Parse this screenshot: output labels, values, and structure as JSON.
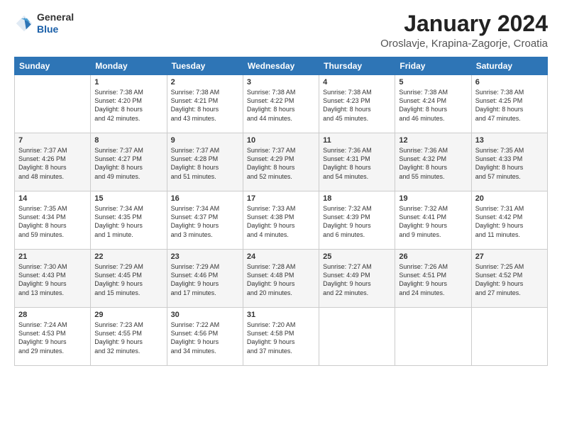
{
  "header": {
    "logo_general": "General",
    "logo_blue": "Blue",
    "month_title": "January 2024",
    "location": "Oroslavje, Krapina-Zagorje, Croatia"
  },
  "weekdays": [
    "Sunday",
    "Monday",
    "Tuesday",
    "Wednesday",
    "Thursday",
    "Friday",
    "Saturday"
  ],
  "weeks": [
    [
      {
        "day": "",
        "sunrise": "",
        "sunset": "",
        "daylight": ""
      },
      {
        "day": "1",
        "sunrise": "Sunrise: 7:38 AM",
        "sunset": "Sunset: 4:20 PM",
        "daylight": "Daylight: 8 hours and 42 minutes."
      },
      {
        "day": "2",
        "sunrise": "Sunrise: 7:38 AM",
        "sunset": "Sunset: 4:21 PM",
        "daylight": "Daylight: 8 hours and 43 minutes."
      },
      {
        "day": "3",
        "sunrise": "Sunrise: 7:38 AM",
        "sunset": "Sunset: 4:22 PM",
        "daylight": "Daylight: 8 hours and 44 minutes."
      },
      {
        "day": "4",
        "sunrise": "Sunrise: 7:38 AM",
        "sunset": "Sunset: 4:23 PM",
        "daylight": "Daylight: 8 hours and 45 minutes."
      },
      {
        "day": "5",
        "sunrise": "Sunrise: 7:38 AM",
        "sunset": "Sunset: 4:24 PM",
        "daylight": "Daylight: 8 hours and 46 minutes."
      },
      {
        "day": "6",
        "sunrise": "Sunrise: 7:38 AM",
        "sunset": "Sunset: 4:25 PM",
        "daylight": "Daylight: 8 hours and 47 minutes."
      }
    ],
    [
      {
        "day": "7",
        "sunrise": "Sunrise: 7:37 AM",
        "sunset": "Sunset: 4:26 PM",
        "daylight": "Daylight: 8 hours and 48 minutes."
      },
      {
        "day": "8",
        "sunrise": "Sunrise: 7:37 AM",
        "sunset": "Sunset: 4:27 PM",
        "daylight": "Daylight: 8 hours and 49 minutes."
      },
      {
        "day": "9",
        "sunrise": "Sunrise: 7:37 AM",
        "sunset": "Sunset: 4:28 PM",
        "daylight": "Daylight: 8 hours and 51 minutes."
      },
      {
        "day": "10",
        "sunrise": "Sunrise: 7:37 AM",
        "sunset": "Sunset: 4:29 PM",
        "daylight": "Daylight: 8 hours and 52 minutes."
      },
      {
        "day": "11",
        "sunrise": "Sunrise: 7:36 AM",
        "sunset": "Sunset: 4:31 PM",
        "daylight": "Daylight: 8 hours and 54 minutes."
      },
      {
        "day": "12",
        "sunrise": "Sunrise: 7:36 AM",
        "sunset": "Sunset: 4:32 PM",
        "daylight": "Daylight: 8 hours and 55 minutes."
      },
      {
        "day": "13",
        "sunrise": "Sunrise: 7:35 AM",
        "sunset": "Sunset: 4:33 PM",
        "daylight": "Daylight: 8 hours and 57 minutes."
      }
    ],
    [
      {
        "day": "14",
        "sunrise": "Sunrise: 7:35 AM",
        "sunset": "Sunset: 4:34 PM",
        "daylight": "Daylight: 8 hours and 59 minutes."
      },
      {
        "day": "15",
        "sunrise": "Sunrise: 7:34 AM",
        "sunset": "Sunset: 4:35 PM",
        "daylight": "Daylight: 9 hours and 1 minute."
      },
      {
        "day": "16",
        "sunrise": "Sunrise: 7:34 AM",
        "sunset": "Sunset: 4:37 PM",
        "daylight": "Daylight: 9 hours and 3 minutes."
      },
      {
        "day": "17",
        "sunrise": "Sunrise: 7:33 AM",
        "sunset": "Sunset: 4:38 PM",
        "daylight": "Daylight: 9 hours and 4 minutes."
      },
      {
        "day": "18",
        "sunrise": "Sunrise: 7:32 AM",
        "sunset": "Sunset: 4:39 PM",
        "daylight": "Daylight: 9 hours and 6 minutes."
      },
      {
        "day": "19",
        "sunrise": "Sunrise: 7:32 AM",
        "sunset": "Sunset: 4:41 PM",
        "daylight": "Daylight: 9 hours and 9 minutes."
      },
      {
        "day": "20",
        "sunrise": "Sunrise: 7:31 AM",
        "sunset": "Sunset: 4:42 PM",
        "daylight": "Daylight: 9 hours and 11 minutes."
      }
    ],
    [
      {
        "day": "21",
        "sunrise": "Sunrise: 7:30 AM",
        "sunset": "Sunset: 4:43 PM",
        "daylight": "Daylight: 9 hours and 13 minutes."
      },
      {
        "day": "22",
        "sunrise": "Sunrise: 7:29 AM",
        "sunset": "Sunset: 4:45 PM",
        "daylight": "Daylight: 9 hours and 15 minutes."
      },
      {
        "day": "23",
        "sunrise": "Sunrise: 7:29 AM",
        "sunset": "Sunset: 4:46 PM",
        "daylight": "Daylight: 9 hours and 17 minutes."
      },
      {
        "day": "24",
        "sunrise": "Sunrise: 7:28 AM",
        "sunset": "Sunset: 4:48 PM",
        "daylight": "Daylight: 9 hours and 20 minutes."
      },
      {
        "day": "25",
        "sunrise": "Sunrise: 7:27 AM",
        "sunset": "Sunset: 4:49 PM",
        "daylight": "Daylight: 9 hours and 22 minutes."
      },
      {
        "day": "26",
        "sunrise": "Sunrise: 7:26 AM",
        "sunset": "Sunset: 4:51 PM",
        "daylight": "Daylight: 9 hours and 24 minutes."
      },
      {
        "day": "27",
        "sunrise": "Sunrise: 7:25 AM",
        "sunset": "Sunset: 4:52 PM",
        "daylight": "Daylight: 9 hours and 27 minutes."
      }
    ],
    [
      {
        "day": "28",
        "sunrise": "Sunrise: 7:24 AM",
        "sunset": "Sunset: 4:53 PM",
        "daylight": "Daylight: 9 hours and 29 minutes."
      },
      {
        "day": "29",
        "sunrise": "Sunrise: 7:23 AM",
        "sunset": "Sunset: 4:55 PM",
        "daylight": "Daylight: 9 hours and 32 minutes."
      },
      {
        "day": "30",
        "sunrise": "Sunrise: 7:22 AM",
        "sunset": "Sunset: 4:56 PM",
        "daylight": "Daylight: 9 hours and 34 minutes."
      },
      {
        "day": "31",
        "sunrise": "Sunrise: 7:20 AM",
        "sunset": "Sunset: 4:58 PM",
        "daylight": "Daylight: 9 hours and 37 minutes."
      },
      {
        "day": "",
        "sunrise": "",
        "sunset": "",
        "daylight": ""
      },
      {
        "day": "",
        "sunrise": "",
        "sunset": "",
        "daylight": ""
      },
      {
        "day": "",
        "sunrise": "",
        "sunset": "",
        "daylight": ""
      }
    ]
  ]
}
